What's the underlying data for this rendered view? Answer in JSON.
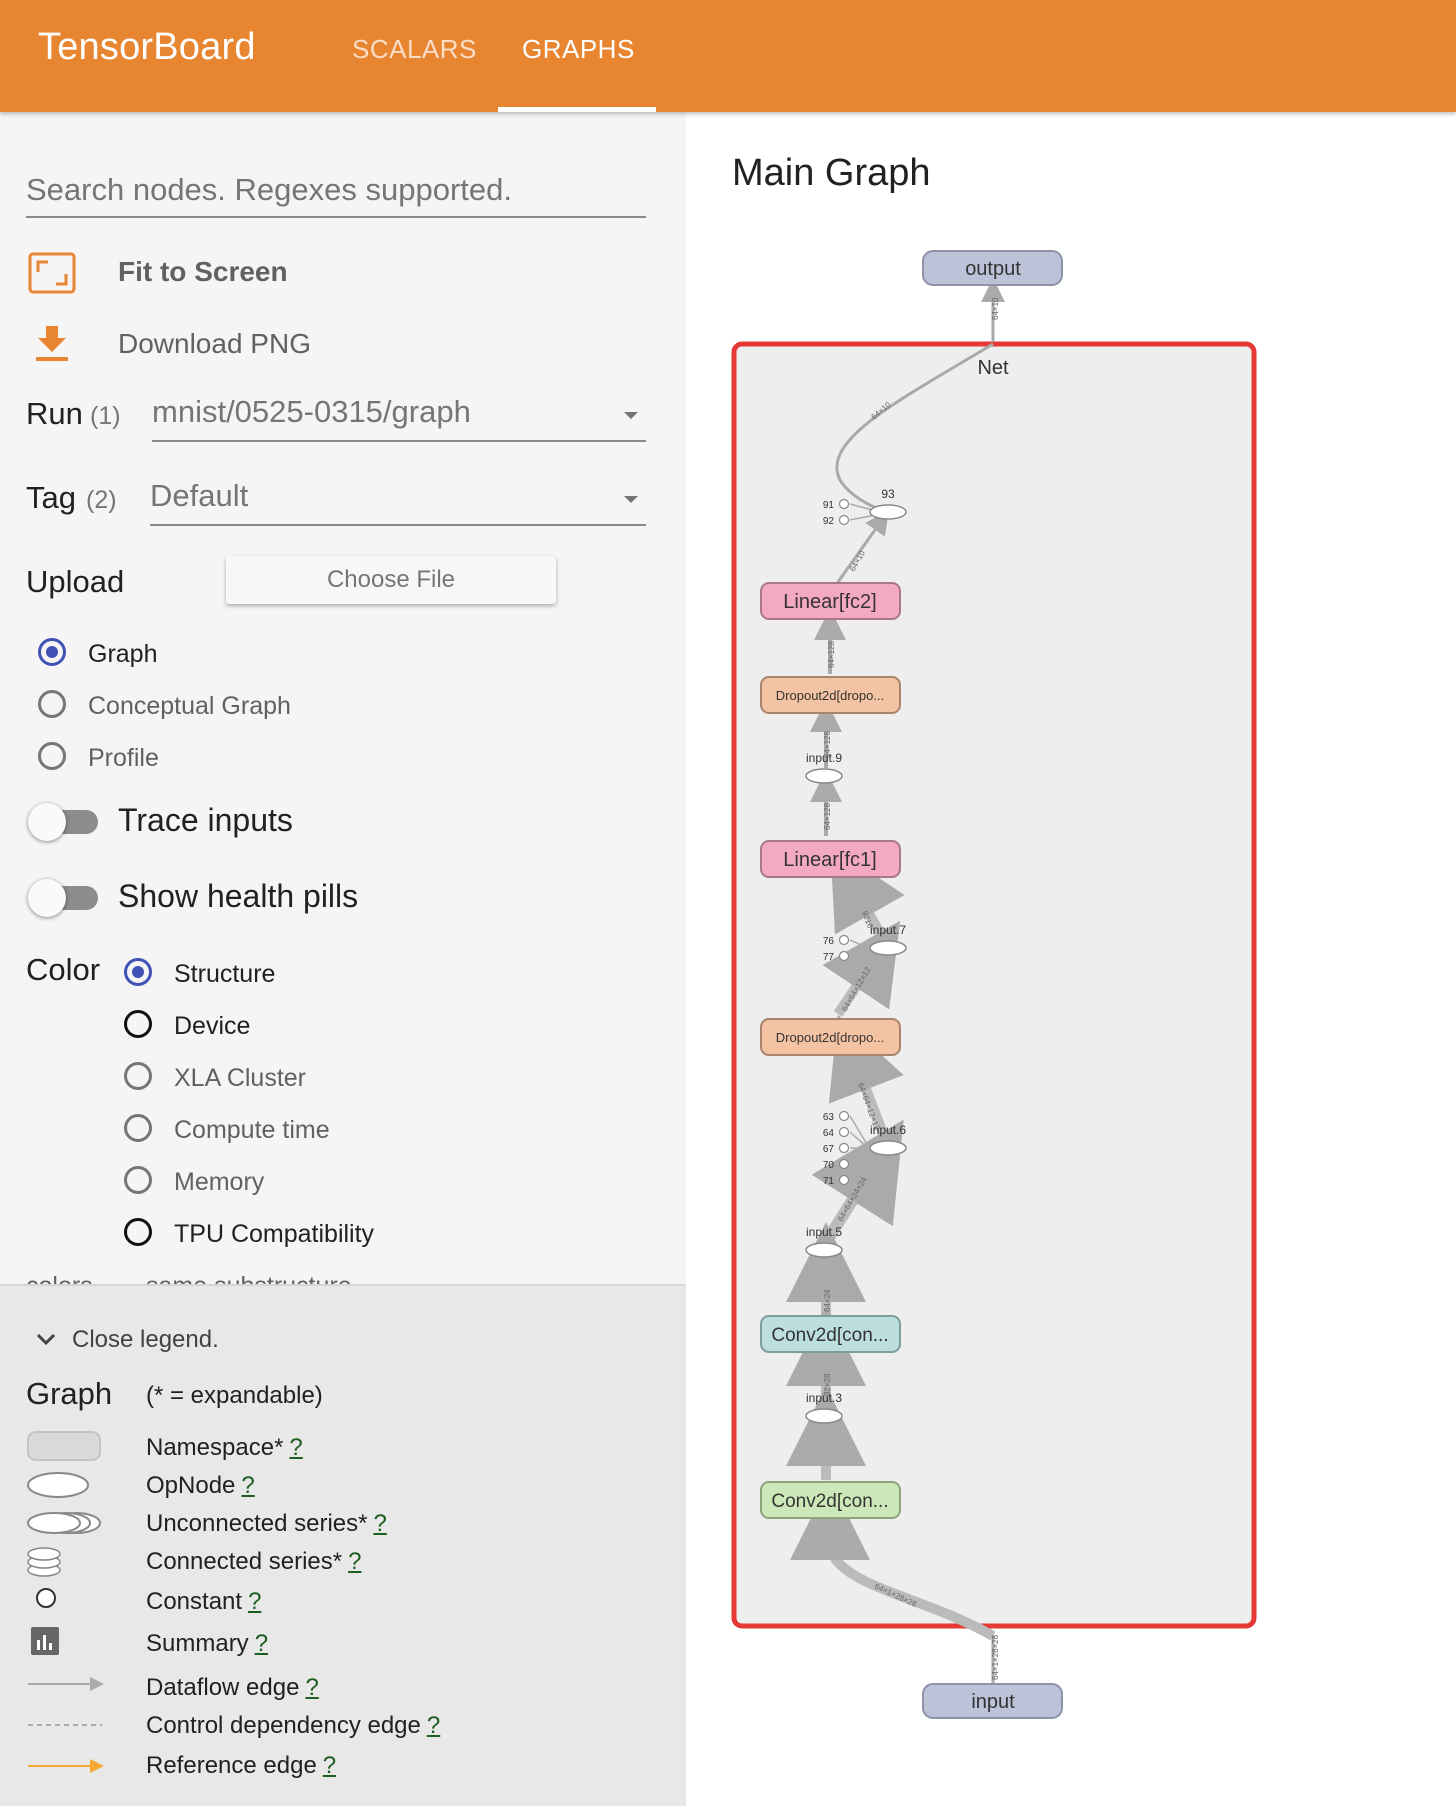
{
  "header": {
    "brand": "TensorBoard",
    "tabs": [
      {
        "label": "SCALARS",
        "active": false
      },
      {
        "label": "GRAPHS",
        "active": true
      }
    ],
    "color": "#e88531"
  },
  "sidebar": {
    "search_placeholder": "Search nodes. Regexes supported.",
    "fit_to_screen": "Fit to Screen",
    "download_png": "Download PNG",
    "run": {
      "label": "Run",
      "count": "(1)",
      "value": "mnist/0525-0315/graph"
    },
    "tag": {
      "label": "Tag",
      "count": "(2)",
      "value": "Default"
    },
    "upload": {
      "label": "Upload",
      "button": "Choose File"
    },
    "graph_types": [
      {
        "label": "Graph",
        "selected": true
      },
      {
        "label": "Conceptual Graph",
        "selected": false
      },
      {
        "label": "Profile",
        "selected": false
      }
    ],
    "trace_inputs": "Trace inputs",
    "show_health_pills": "Show health pills",
    "color": {
      "label": "Color",
      "options": [
        {
          "label": "Structure",
          "selected": true
        },
        {
          "label": "Device",
          "selected": false
        },
        {
          "label": "XLA Cluster",
          "selected": false
        },
        {
          "label": "Compute time",
          "selected": false
        },
        {
          "label": "Memory",
          "selected": false
        },
        {
          "label": "TPU Compatibility",
          "selected": false
        }
      ]
    },
    "cut_text": {
      "left": "colors",
      "right": "same substructure"
    }
  },
  "legend": {
    "close": "Close legend.",
    "title": "Graph",
    "note": "(* = expandable)",
    "q": "?",
    "items": [
      {
        "label": "Namespace*",
        "icon": "namespace-icon"
      },
      {
        "label": "OpNode",
        "icon": "opnode-icon"
      },
      {
        "label": "Unconnected series*",
        "icon": "unconnected-series-icon"
      },
      {
        "label": "Connected series*",
        "icon": "connected-series-icon"
      },
      {
        "label": "Constant",
        "icon": "constant-icon"
      },
      {
        "label": "Summary",
        "icon": "summary-icon"
      },
      {
        "label": "Dataflow edge",
        "icon": "dataflow-edge-icon"
      },
      {
        "label": "Control dependency edge",
        "icon": "control-edge-icon"
      },
      {
        "label": "Reference edge",
        "icon": "reference-edge-icon"
      }
    ]
  },
  "graph": {
    "title": "Main Graph",
    "output": "output",
    "input": "input",
    "namespace": "Net",
    "nodes": {
      "fc2": "Linear[fc2]",
      "drop2": "Dropout2d[dropo...",
      "fc1": "Linear[fc1]",
      "drop1": "Dropout2d[dropo...",
      "conv2": "Conv2d[con...",
      "conv1": "Conv2d[con..."
    },
    "ops": {
      "op93": "93",
      "input9": "input.9",
      "input7": "input.7",
      "input6": "input.6",
      "input5": "input.5",
      "input3": "input.3"
    },
    "constants": {
      "c91": "91",
      "c92": "92",
      "c76": "76",
      "c77": "77",
      "c63": "63",
      "c64": "64",
      "c67": "67",
      "c70": "70",
      "c71": "71"
    },
    "edges": {
      "e_out": "64×10",
      "e_net": "64×10",
      "e_93": "64×10",
      "e_fc2": "64×128",
      "e_drop2": "64×128",
      "e_in9": "64×128",
      "e_fc1": "9216",
      "e_in7": "64×64×12×12",
      "e_drop1": "64×64×12×12",
      "e_in6": "64×64×24×24",
      "e_conv2": "64×24",
      "e_in3": "32×28",
      "e_conv1": "64×1×28×28",
      "e_input": "64×1×28×28"
    },
    "colors": {
      "highlight": "#e53935",
      "io_node": "#bcc3d8",
      "linear": "#f3a9bf",
      "dropout": "#f4c3a3",
      "conv2": "#bcdedf",
      "conv1": "#cde8b8",
      "namespace_bg": "#eeeeee"
    }
  }
}
